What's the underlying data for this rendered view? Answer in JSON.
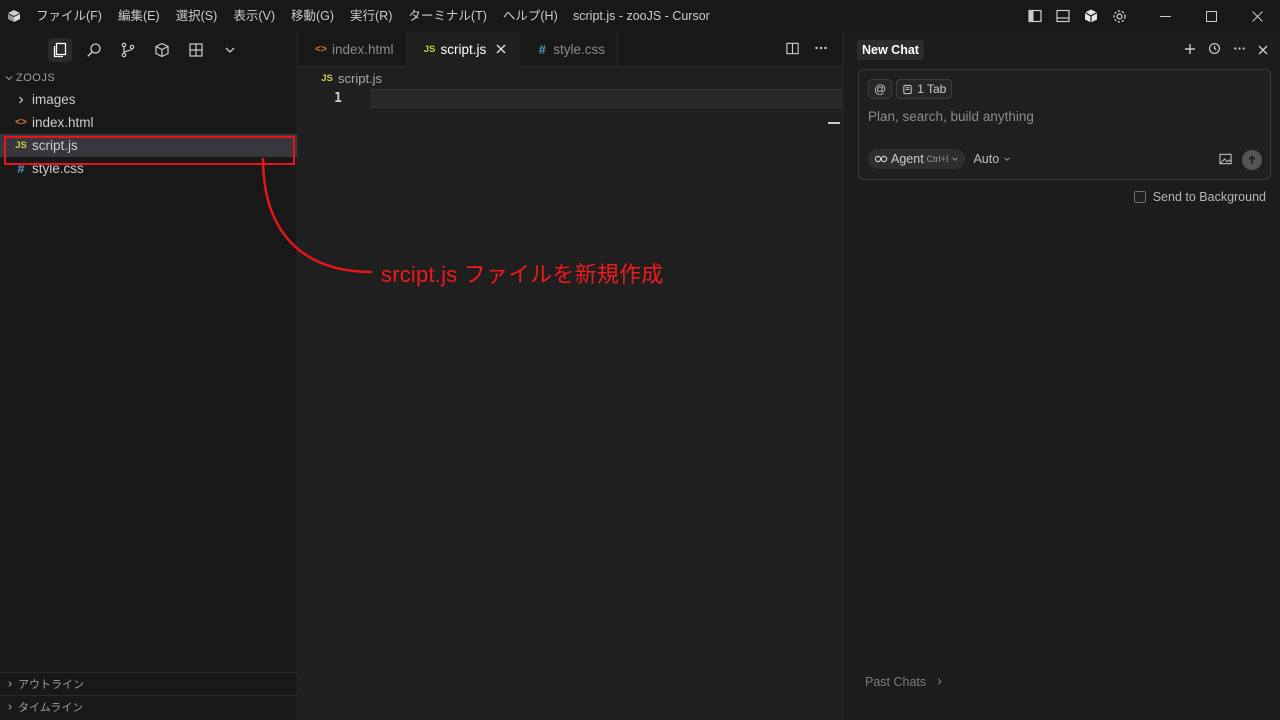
{
  "titlebar": {
    "menus": [
      "ファイル(F)",
      "編集(E)",
      "選択(S)",
      "表示(V)",
      "移動(G)",
      "実行(R)",
      "ターミナル(T)",
      "ヘルプ(H)"
    ],
    "window_title": "script.js - zooJS - Cursor",
    "icons": [
      "layout-sidebar-icon",
      "layout-panel-icon",
      "cube-icon",
      "gear-icon"
    ]
  },
  "sidebar": {
    "activity_icons": [
      "explorer-icon",
      "search-icon",
      "source-control-icon",
      "extensions-icon",
      "grid-icon",
      "chevron-down-icon"
    ],
    "folder_title": "ZOOJS",
    "items": [
      {
        "label": "images",
        "type": "folder",
        "icon": "chevron-right-icon"
      },
      {
        "label": "index.html",
        "type": "html",
        "icon": "<>"
      },
      {
        "label": "script.js",
        "type": "js",
        "icon": "JS",
        "selected": true
      },
      {
        "label": "style.css",
        "type": "css",
        "icon": "#"
      }
    ],
    "outline_label": "アウトライン",
    "timeline_label": "タイムライン"
  },
  "editor": {
    "tabs": [
      {
        "label": "index.html",
        "icon": "<>",
        "active": false
      },
      {
        "label": "script.js",
        "icon": "JS",
        "active": true
      },
      {
        "label": "style.css",
        "icon": "#",
        "active": false
      }
    ],
    "breadcrumb_icon": "JS",
    "breadcrumb": "script.js",
    "line_number": "1"
  },
  "chat": {
    "tab_label": "New Chat",
    "chip_at": "@",
    "chip_tab": "1 Tab",
    "placeholder": "Plan, search, build anything",
    "agent_label": "Agent",
    "agent_shortcut": "Ctrl+I",
    "model_label": "Auto",
    "send_to_background": "Send to Background",
    "past_chats": "Past Chats"
  },
  "annotation": {
    "text": "srcipt.js ファイルを新規作成",
    "color": "#e8141c"
  }
}
